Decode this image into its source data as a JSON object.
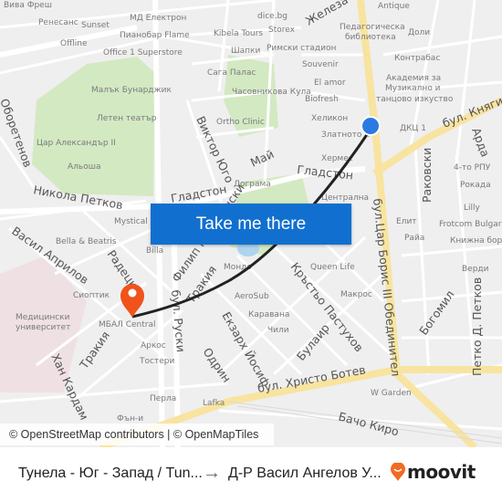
{
  "map": {
    "pois": [
      "Вива Фреш",
      "Ренесанс",
      "Sunset",
      "МД Електрон",
      "Пианобар Flame",
      "Kibela Tours",
      "Offline",
      "Office 1 Superstore",
      "Шапки",
      "Сага Палас",
      "Часовникова Кула",
      "Малък Бунарджик",
      "Летен театър",
      "Ortho Clinic",
      "Цар Александър II",
      "Альоша",
      "dice.bg",
      "Storex",
      "Римски стадион",
      "Souvenir",
      "El amor",
      "Biofresh",
      "Хеликон",
      "Златното п",
      "Хермес",
      "Antique",
      "Педагогическа",
      "библиотека",
      "Доли",
      "Контрабас",
      "Академия за",
      "Музикално и",
      "танцово изкуство",
      "ДКЦ 1",
      "4-то РПУ",
      "Рокада",
      "Lilly",
      "Дограма",
      "Централна",
      "Mystical",
      "Bella & Beatris",
      "Billa",
      "Сиоптик",
      "Медицински",
      "университет",
      "МБАЛ Central",
      "Аркос",
      "Тостери",
      "Перла",
      "Lafka",
      "Фън-и",
      "Елит",
      "Frotcom Bulgaria",
      "Райа",
      "Книжна борса",
      "Верди",
      "Queen Life",
      "Макрос",
      "AeroSub",
      "Каравана",
      "Чили",
      "W Garden",
      "Мондо"
    ],
    "streets": [
      "Виктор Юго",
      "Гладстон",
      "Гладстон",
      "Никола Петков",
      "Май",
      "Железа",
      "бул. Княгиня",
      "Арда",
      "Раковски",
      "бул.Цар Борис III Обединител",
      "Богомил",
      "Петко Д. Петков",
      "Кръстьо Пастухов",
      "Булаир",
      "бул. Христо Ботев",
      "Бачо Киро",
      "Васил Априлов",
      "Радецки",
      "Филип Македонски",
      "Тракия",
      "Тракия",
      "бул. Руски",
      "Екзарх Йосиф",
      "Одрин",
      "Хан Кардам",
      "Оборетенов"
    ],
    "origin_marker_color": "#2a7ae2",
    "destination_marker_color": "#f0531c",
    "route_color": "#222222"
  },
  "cta": {
    "label": "Take me there",
    "color": "#1170cf"
  },
  "attribution": "© OpenStreetMap contributors | © OpenMapTiles",
  "footer": {
    "from": "Тунела - Юг - Запад / Tun...",
    "arrow": "→",
    "to": "Д-Р Васил Ангелов У...",
    "brand": "moovit",
    "brand_color": "#f26b21"
  }
}
